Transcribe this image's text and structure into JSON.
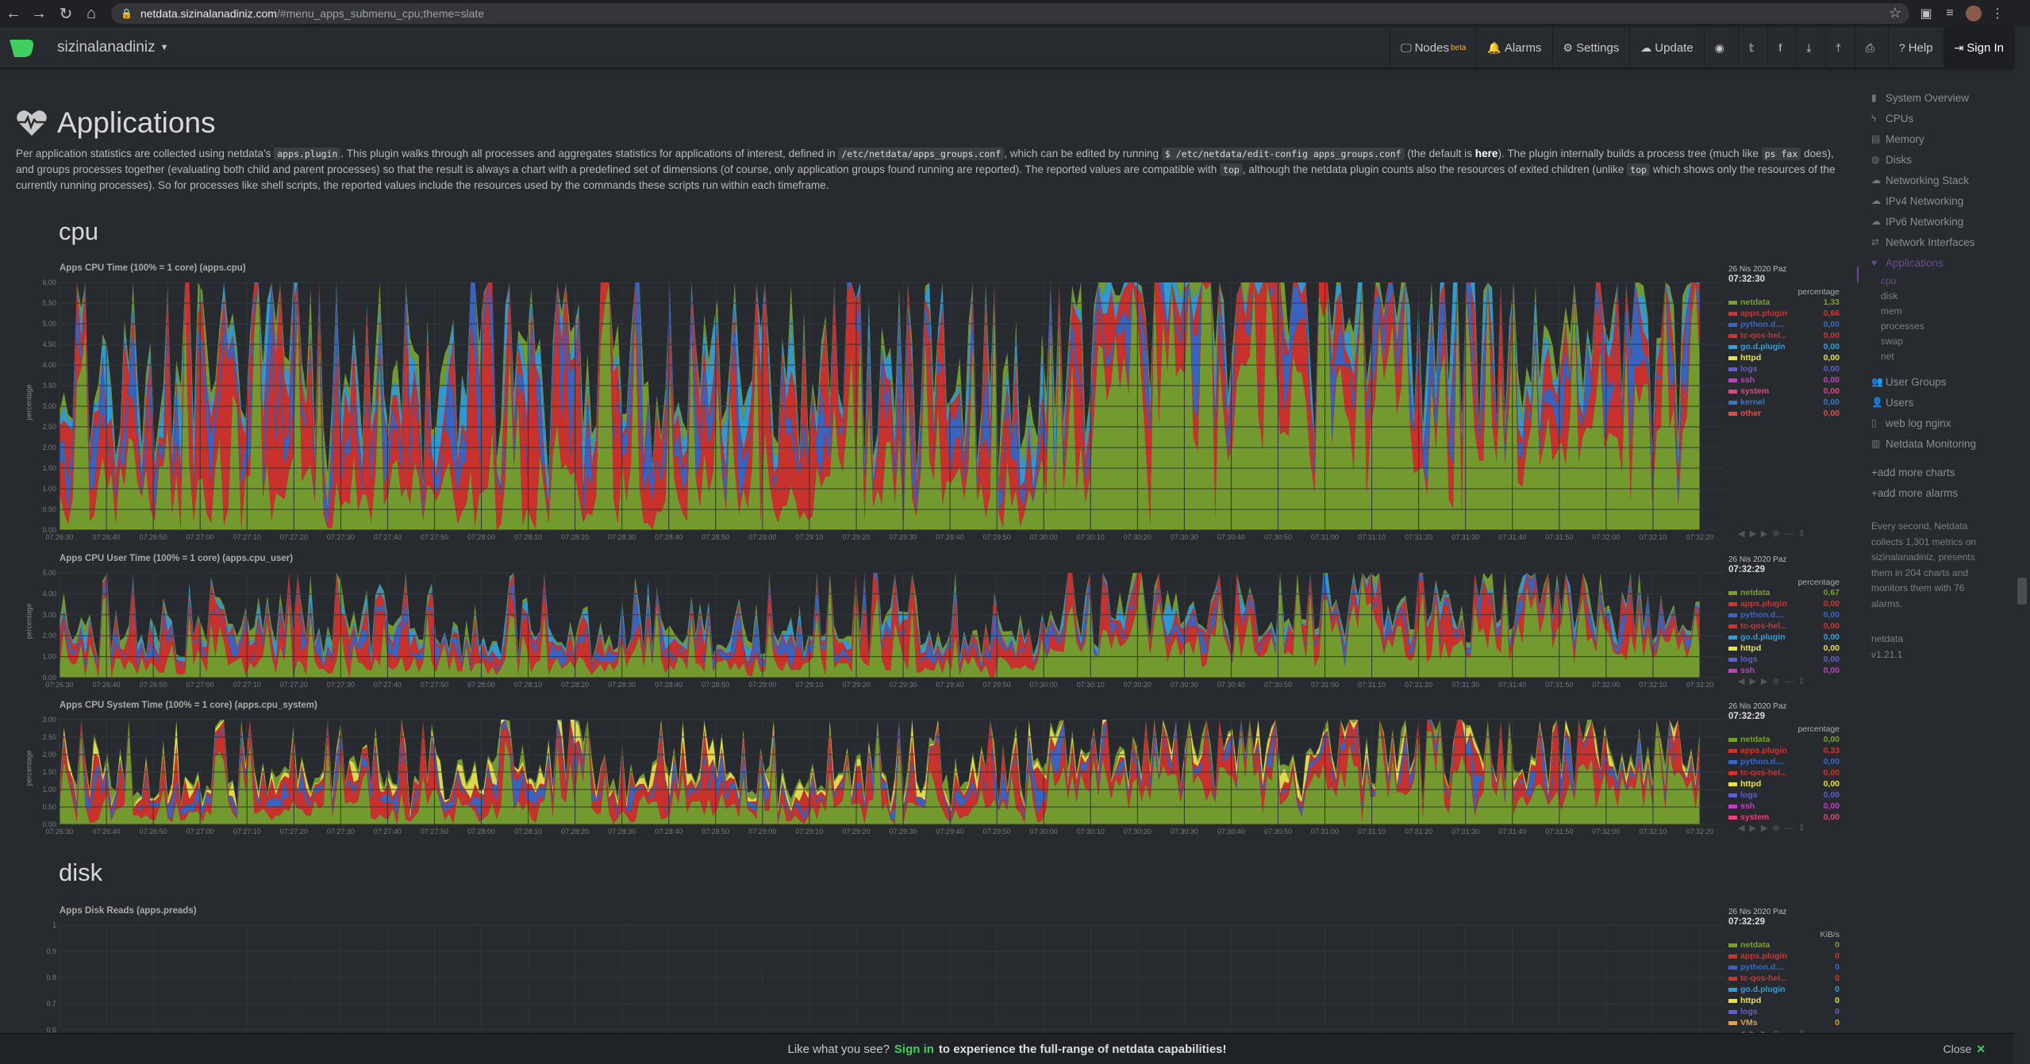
{
  "browser": {
    "url_host": "netdata.sizinalanadiniz.com",
    "url_path": "/#menu_apps_submenu_cpu;theme=slate"
  },
  "header": {
    "brand": "sizinalanadiniz",
    "nav": [
      {
        "label": "Nodes",
        "icon": "monitor-icon",
        "badge": "beta"
      },
      {
        "label": "Alarms",
        "icon": "bell-icon"
      },
      {
        "label": "Settings",
        "icon": "gear-icon"
      },
      {
        "label": "Update",
        "icon": "cloud-download-icon"
      }
    ],
    "help_label": "Help",
    "signin_label": "Sign In"
  },
  "page": {
    "title": "Applications",
    "intro": {
      "t1": "Per application statistics are collected using netdata's ",
      "c1": "apps.plugin",
      "t2": ". This plugin walks through all processes and aggregates statistics for applications of interest, defined in ",
      "c2": "/etc/netdata/apps_groups.conf",
      "t3": ", which can be edited by running ",
      "c3": "$ /etc/netdata/edit-config apps_groups.conf",
      "t4": " (the default is ",
      "link": "here",
      "t5": "). The plugin internally builds a process tree (much like ",
      "c4": "ps fax",
      "t6": " does), and groups processes together (evaluating both child and parent processes) so that the result is always a chart with a predefined set of dimensions (of course, only application groups found running are reported). The reported values are compatible with ",
      "c5": "top",
      "t7": ", although the netdata plugin counts also the resources of exited children (unlike ",
      "c6": "top",
      "t8": " which shows only the resources of the currently running processes). So for processes like shell scripts, the reported values include the resources used by the commands these scripts run within each timeframe."
    },
    "sections": {
      "cpu": "cpu",
      "disk": "disk"
    }
  },
  "x_ticks": [
    "07:26:30",
    "07:26:40",
    "07:26:50",
    "07:27:00",
    "07:27:10",
    "07:27:20",
    "07:27:30",
    "07:27:40",
    "07:27:50",
    "07:28:00",
    "07:28:10",
    "07:28:20",
    "07:28:30",
    "07:28:40",
    "07:28:50",
    "07:29:00",
    "07:29:10",
    "07:29:20",
    "07:29:30",
    "07:29:40",
    "07:29:50",
    "07:30:00",
    "07:30:10",
    "07:30:20",
    "07:30:30",
    "07:30:40",
    "07:30:50",
    "07:31:00",
    "07:31:10",
    "07:31:20",
    "07:31:30",
    "07:31:40",
    "07:31:50",
    "07:32:00",
    "07:32:10",
    "07:32:20"
  ],
  "charts": [
    {
      "id": "apps-cpu",
      "title": "Apps CPU Time (100% = 1 core) (apps.cpu)",
      "ylabel": "percentage",
      "date": "26 Nis 2020 Paz",
      "time": "07:32:30",
      "units": "percentage",
      "yticks": [
        "6.00",
        "5.50",
        "5.00",
        "4.50",
        "4.00",
        "3.50",
        "3.00",
        "2.50",
        "2.00",
        "1.50",
        "1.00",
        "0.50",
        "0.00"
      ],
      "ymax": 6,
      "legend": [
        {
          "name": "netdata",
          "value": "1,33",
          "color": "#77a02e"
        },
        {
          "name": "apps.plugin",
          "value": "0,66",
          "color": "#d2322d"
        },
        {
          "name": "python.d....",
          "value": "0,00",
          "color": "#3a66c9"
        },
        {
          "name": "tc-qos-hel...",
          "value": "0,00",
          "color": "#d2322d"
        },
        {
          "name": "go.d.plugin",
          "value": "0,00",
          "color": "#2f9fdd"
        },
        {
          "name": "httpd",
          "value": "0,00",
          "color": "#e8e24e"
        },
        {
          "name": "logs",
          "value": "0,00",
          "color": "#5f5fcf"
        },
        {
          "name": "ssh",
          "value": "0,00",
          "color": "#c03fc0"
        },
        {
          "name": "system",
          "value": "0,00",
          "color": "#e5447e"
        },
        {
          "name": "kernel",
          "value": "0,00",
          "color": "#3a76c0"
        },
        {
          "name": "other",
          "value": "0,00",
          "color": "#e84a4a"
        }
      ]
    },
    {
      "id": "apps-cpu-user",
      "title": "Apps CPU User Time (100% = 1 core) (apps.cpu_user)",
      "ylabel": "percentage",
      "date": "26 Nis 2020 Paz",
      "time": "07:32:29",
      "units": "percentage",
      "yticks": [
        "5.00",
        "4.00",
        "3.00",
        "2.00",
        "1.00",
        "0.00"
      ],
      "ymax": 5,
      "legend": [
        {
          "name": "netdata",
          "value": "0,67",
          "color": "#77a02e"
        },
        {
          "name": "apps.plugin",
          "value": "0,00",
          "color": "#d2322d"
        },
        {
          "name": "python.d....",
          "value": "0,00",
          "color": "#3a66c9"
        },
        {
          "name": "tc-qos-hel...",
          "value": "0,00",
          "color": "#d2322d"
        },
        {
          "name": "go.d.plugin",
          "value": "0,00",
          "color": "#2f9fdd"
        },
        {
          "name": "httpd",
          "value": "0,00",
          "color": "#e8e24e"
        },
        {
          "name": "logs",
          "value": "0,00",
          "color": "#5f5fcf"
        },
        {
          "name": "ssh",
          "value": "0,00",
          "color": "#c03fc0"
        }
      ]
    },
    {
      "id": "apps-cpu-system",
      "title": "Apps CPU System Time (100% = 1 core) (apps.cpu_system)",
      "ylabel": "percentage",
      "date": "26 Nis 2020 Paz",
      "time": "07:32:29",
      "units": "percentage",
      "yticks": [
        "3.00",
        "2.50",
        "2.00",
        "1.50",
        "1.00",
        "0.50",
        "0.00"
      ],
      "ymax": 3,
      "legend": [
        {
          "name": "netdata",
          "value": "0,00",
          "color": "#77a02e"
        },
        {
          "name": "apps.plugin",
          "value": "0,33",
          "color": "#d2322d"
        },
        {
          "name": "python.d....",
          "value": "0,00",
          "color": "#3a66c9"
        },
        {
          "name": "tc-qos-hel...",
          "value": "0,00",
          "color": "#d2322d"
        },
        {
          "name": "httpd",
          "value": "0,00",
          "color": "#e8e24e"
        },
        {
          "name": "logs",
          "value": "0,00",
          "color": "#5f5fcf"
        },
        {
          "name": "ssh",
          "value": "0,00",
          "color": "#c03fc0"
        },
        {
          "name": "system",
          "value": "0,00",
          "color": "#e5447e"
        }
      ]
    },
    {
      "id": "apps-preads",
      "title": "Apps Disk Reads (apps.preads)",
      "ylabel": "",
      "date": "26 Nis 2020 Paz",
      "time": "07:32:29",
      "units": "KiB/s",
      "yticks": [
        "1",
        "0.9",
        "0.8",
        "0.7",
        "0.6"
      ],
      "ymax": 1,
      "legend": [
        {
          "name": "netdata",
          "value": "0",
          "color": "#77a02e"
        },
        {
          "name": "apps.plugin",
          "value": "0",
          "color": "#d2322d"
        },
        {
          "name": "python.d....",
          "value": "0",
          "color": "#3a66c9"
        },
        {
          "name": "tc-qos-hel...",
          "value": "0",
          "color": "#d2322d"
        },
        {
          "name": "go.d.plugin",
          "value": "0",
          "color": "#2f9fdd"
        },
        {
          "name": "httpd",
          "value": "0",
          "color": "#e8e24e"
        },
        {
          "name": "logs",
          "value": "0",
          "color": "#5f5fcf"
        },
        {
          "name": "VMs",
          "value": "0",
          "color": "#e8a030"
        }
      ]
    }
  ],
  "sidebar": {
    "items": [
      {
        "label": "System Overview",
        "icon": "bookmark-icon"
      },
      {
        "label": "CPUs",
        "icon": "bolt-icon"
      },
      {
        "label": "Memory",
        "icon": "memory-icon"
      },
      {
        "label": "Disks",
        "icon": "disk-icon"
      },
      {
        "label": "Networking Stack",
        "icon": "cloud-icon"
      },
      {
        "label": "IPv4 Networking",
        "icon": "cloud-icon"
      },
      {
        "label": "IPv6 Networking",
        "icon": "cloud-icon"
      },
      {
        "label": "Network Interfaces",
        "icon": "network-icon"
      },
      {
        "label": "Applications",
        "icon": "heart-icon",
        "active": true
      }
    ],
    "subitems": [
      "cpu",
      "disk",
      "mem",
      "processes",
      "swap",
      "net"
    ],
    "items2": [
      {
        "label": "User Groups",
        "icon": "users-icon"
      },
      {
        "label": "Users",
        "icon": "user-icon"
      },
      {
        "label": "web log nginx",
        "icon": "file-icon"
      },
      {
        "label": "Netdata Monitoring",
        "icon": "chart-icon"
      }
    ],
    "add_charts": "add more charts",
    "add_alarms": "add more alarms",
    "info": "Every second, Netdata collects 1,301 metrics on sizinalanadiniz, presents them in 204 charts and monitors them with 76 alarms.",
    "product": "netdata",
    "version": "v1.21.1"
  },
  "banner": {
    "pre": "Like what you see?",
    "link": "Sign in",
    "post": "to experience the full-range of netdata capabilities!",
    "close": "Close"
  },
  "colors": {
    "bg": "#272b30",
    "accent": "#3ecf5e",
    "active": "#6b4a8f"
  }
}
